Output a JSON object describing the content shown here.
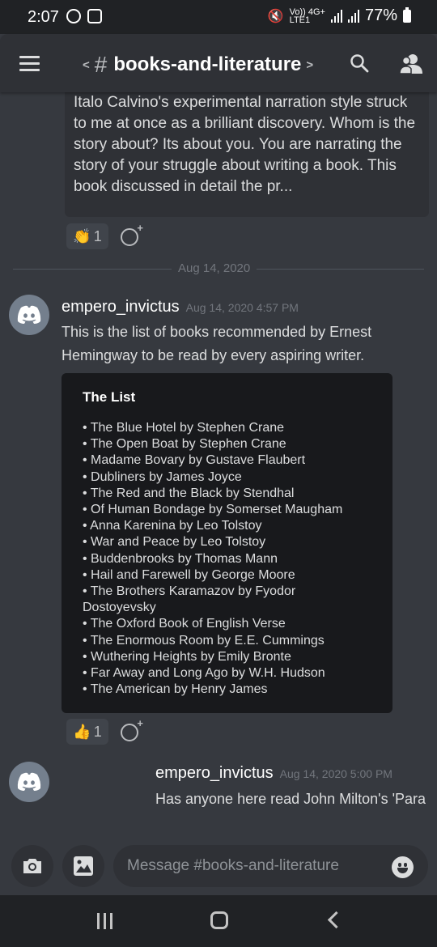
{
  "status_bar": {
    "time": "2:07",
    "network_label_top": "Vo)) 4G+",
    "network_label_bottom": "LTE1",
    "battery": "77%"
  },
  "header": {
    "channel_name": "books-and-literature",
    "hash": "#",
    "prev_arrow": "<",
    "next_arrow": ">"
  },
  "messages": {
    "previous_embed_text": "Italo Calvino's experimental narration style struck to me at once as a brilliant discovery. Whom is the story about? Its about you. You are narrating the story of your struggle about writing a book. This book discussed in detail the pr...",
    "previous_reaction": {
      "emoji": "👏",
      "count": "1"
    },
    "date_divider": "Aug 14, 2020",
    "message1": {
      "username": "empero_invictus",
      "timestamp": "Aug 14, 2020 4:57 PM",
      "text_line1": "This is the list of books recommended by Ernest",
      "text_line2": "Hemingway to be read by every aspiring writer.",
      "embed": {
        "title": "The List",
        "items": [
          "• The Blue Hotel by Stephen Crane",
          "• The Open Boat by Stephen Crane",
          "• Madame Bovary by Gustave Flaubert",
          "• Dubliners by James Joyce",
          "• The Red and the Black by Stendhal",
          "• Of Human Bondage by Somerset Maugham",
          "• Anna Karenina by Leo Tolstoy",
          "• War and Peace by Leo Tolstoy",
          "• Buddenbrooks by Thomas Mann",
          "• Hail and Farewell by George Moore",
          "• The Brothers Karamazov by Fyodor",
          "Dostoyevsky",
          "• The Oxford Book of English Verse",
          "• The Enormous Room by E.E. Cummings",
          "• Wuthering Heights by Emily Bronte",
          "• Far Away and Long Ago by W.H. Hudson",
          "• The American by Henry James"
        ]
      },
      "reaction": {
        "emoji": "👍",
        "count": "1"
      }
    },
    "message2": {
      "username": "empero_invictus",
      "timestamp": "Aug 14, 2020 5:00 PM",
      "text": "Has anyone here read John Milton's 'Para"
    }
  },
  "input": {
    "placeholder": "Message #books-and-literature"
  },
  "icons": {
    "status_left": [
      "whatsapp-icon",
      "sim-icon"
    ],
    "header": [
      "menu-icon",
      "search-icon",
      "members-icon"
    ],
    "input": [
      "camera-icon",
      "image-icon",
      "emoji-icon"
    ],
    "nav": [
      "recent-apps-icon",
      "home-icon",
      "back-icon"
    ]
  },
  "colors": {
    "background": "#36393f",
    "header": "#2f3136",
    "embed": "#18191c",
    "avatar": "#747f8d",
    "muted": "#72767d"
  }
}
